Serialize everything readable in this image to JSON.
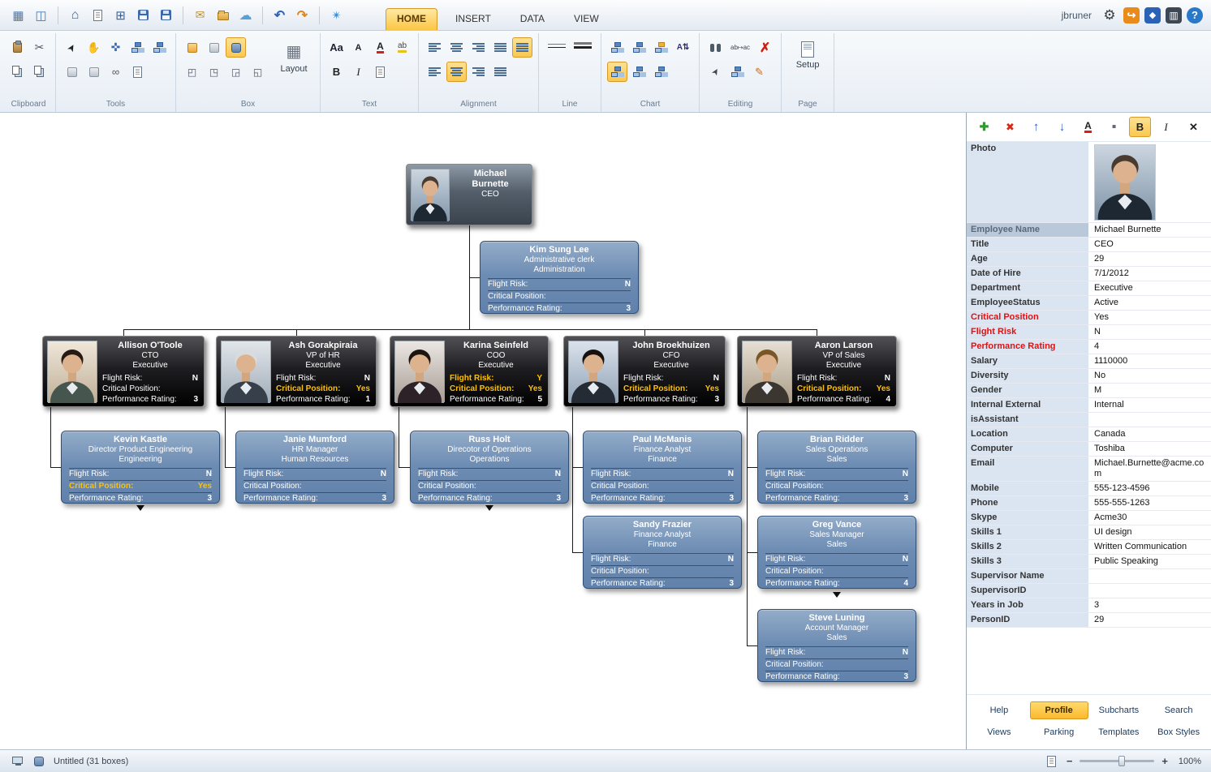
{
  "app": {
    "user": "jbruner",
    "tabs": [
      {
        "label": "HOME",
        "active": true
      },
      {
        "label": "INSERT",
        "active": false
      },
      {
        "label": "DATA",
        "active": false
      },
      {
        "label": "VIEW",
        "active": false
      }
    ]
  },
  "titlebar": {
    "left_icons": [
      "new-chart-wizard-icon",
      "photo-board-icon",
      "home-icon",
      "new-document-icon",
      "new-from-template-icon",
      "save-icon",
      "save-as-icon",
      "send-email-icon",
      "open-folder-icon",
      "cloud-share-icon",
      "undo-icon",
      "redo-icon",
      "help-online-icon"
    ],
    "right_icons": [
      "settings-gear-icon",
      "sign-out-icon",
      "premium-icon",
      "panels-icon",
      "help-icon"
    ]
  },
  "ribbon": {
    "groups": [
      {
        "label": "Clipboard",
        "rows": [
          [
            "paste-icon",
            "cut-icon"
          ],
          [
            "copy-icon",
            "duplicate-icon"
          ]
        ]
      },
      {
        "label": "Tools",
        "rows": [
          [
            "select-tool-icon",
            "pan-tool-icon",
            "move-tool-icon",
            "org-insert-icon",
            "org-subchart-icon"
          ],
          [
            "box-grid-icon",
            "box-remove-icon",
            "link-tool-icon",
            "note-tool-icon"
          ]
        ]
      },
      {
        "label": "Box",
        "rows": [
          [
            "box-style-gold-icon",
            "box-style-plain-icon",
            {
              "n": "box-style-current-icon",
              "sel": true
            }
          ],
          [
            "corner-square-icon",
            "corner-rounded-icon",
            "corner-cut-icon",
            "box-border-icon"
          ]
        ],
        "big": [
          {
            "name": "layout-button",
            "label": "Layout",
            "icon": "layout-grid-icon"
          }
        ]
      },
      {
        "label": "Text",
        "rows": [
          [
            "font-name-icon",
            "font-size-icon",
            "font-color-icon",
            "highlight-color-icon"
          ],
          [
            "bold-icon",
            "italic-icon",
            "text-fields-icon"
          ]
        ]
      },
      {
        "label": "Alignment",
        "rows": [
          [
            "align-left-icon",
            "align-center-icon",
            "align-right-icon",
            "align-justify-icon",
            {
              "n": "wrap-text-icon",
              "sel": true
            }
          ],
          [
            "valign-top-icon",
            {
              "n": "valign-middle-icon",
              "sel": true
            },
            "valign-bottom-icon",
            "distribute-icon"
          ]
        ]
      },
      {
        "label": "Line",
        "rows": [
          [
            "line-style-icon",
            "line-weight-icon"
          ]
        ]
      },
      {
        "label": "Chart",
        "rows": [
          [
            "layout-tree-icon",
            "layout-list-icon",
            "chart-color-icon",
            "sort-icon"
          ],
          [
            {
              "n": "chart-style-classic-icon",
              "sel": true
            },
            "chart-style-modern-icon",
            "chart-style-compact-icon"
          ]
        ]
      },
      {
        "label": "Editing",
        "rows": [
          [
            "find-icon",
            "replace-icon",
            "delete-box-icon"
          ],
          [
            "select-levels-icon",
            "insert-multi-icon",
            "format-painter-icon"
          ]
        ]
      },
      {
        "label": "Page",
        "rows": [],
        "big": [
          {
            "name": "page-setup-button",
            "label": "Setup",
            "icon": "page-setup-icon"
          }
        ]
      }
    ]
  },
  "org": {
    "boxes": [
      {
        "id": "michael",
        "style": "ceo",
        "name": "Michael Burnette",
        "title": "CEO",
        "dept": "",
        "fields": []
      },
      {
        "id": "kim",
        "style": "blue",
        "name": "Kim Sung Lee",
        "title": "Administrative clerk",
        "dept": "Administration",
        "fields": [
          {
            "label": "Flight Risk:",
            "value": "N"
          },
          {
            "label": "Critical Position:",
            "value": ""
          },
          {
            "label": "Performance Rating:",
            "value": "3"
          }
        ]
      },
      {
        "id": "allison",
        "style": "exec",
        "name": "Allison O'Toole",
        "title": "CTO",
        "dept": "Executive",
        "fields": [
          {
            "label": "Flight Risk:",
            "value": "N"
          },
          {
            "label": "Critical Position:",
            "value": ""
          },
          {
            "label": "Performance Rating:",
            "value": "3"
          }
        ]
      },
      {
        "id": "ash",
        "style": "exec",
        "name": "Ash Gorakpiraia",
        "title": "VP of HR",
        "dept": "Executive",
        "fields": [
          {
            "label": "Flight Risk:",
            "value": "N"
          },
          {
            "label": "Critical Position:",
            "value": "Yes",
            "hl": true
          },
          {
            "label": "Performance Rating:",
            "value": "1"
          }
        ]
      },
      {
        "id": "karina",
        "style": "exec",
        "name": "Karina Seinfeld",
        "title": "COO",
        "dept": "Executive",
        "fields": [
          {
            "label": "Flight Risk:",
            "value": "Y",
            "hl": true
          },
          {
            "label": "Critical Position:",
            "value": "Yes",
            "hl": true
          },
          {
            "label": "Performance Rating:",
            "value": "5"
          }
        ]
      },
      {
        "id": "john",
        "style": "exec",
        "name": "John Broekhuizen",
        "title": "CFO",
        "dept": "Executive",
        "fields": [
          {
            "label": "Flight Risk:",
            "value": "N"
          },
          {
            "label": "Critical Position:",
            "value": "Yes",
            "hl": true
          },
          {
            "label": "Performance Rating:",
            "value": "3"
          }
        ]
      },
      {
        "id": "aaron",
        "style": "exec",
        "name": "Aaron Larson",
        "title": "VP of Sales",
        "dept": "Executive",
        "fields": [
          {
            "label": "Flight Risk:",
            "value": "N"
          },
          {
            "label": "Critical Position:",
            "value": "Yes",
            "hl": true
          },
          {
            "label": "Performance Rating:",
            "value": "4"
          }
        ]
      },
      {
        "id": "kevin",
        "style": "blue",
        "name": "Kevin Kastle",
        "title": "Director Product Engineering",
        "dept": "Engineering",
        "fields": [
          {
            "label": "Flight Risk:",
            "value": "N"
          },
          {
            "label": "Critical Position:",
            "value": "Yes",
            "hl": true
          },
          {
            "label": "Performance Rating:",
            "value": "3"
          }
        ]
      },
      {
        "id": "janie",
        "style": "blue",
        "name": "Janie Mumford",
        "title": "HR Manager",
        "dept": "Human Resources",
        "fields": [
          {
            "label": "Flight Risk:",
            "value": "N"
          },
          {
            "label": "Critical Position:",
            "value": ""
          },
          {
            "label": "Performance Rating:",
            "value": "3"
          }
        ]
      },
      {
        "id": "russ",
        "style": "blue",
        "name": "Russ Holt",
        "title": "Direcotor of Operations",
        "dept": "Operations",
        "fields": [
          {
            "label": "Flight Risk:",
            "value": "N"
          },
          {
            "label": "Critical Position:",
            "value": ""
          },
          {
            "label": "Performance Rating:",
            "value": "3"
          }
        ]
      },
      {
        "id": "paul",
        "style": "blue",
        "name": "Paul McManis",
        "title": "Finance Analyst",
        "dept": "Finance",
        "fields": [
          {
            "label": "Flight Risk:",
            "value": "N"
          },
          {
            "label": "Critical Position:",
            "value": ""
          },
          {
            "label": "Performance Rating:",
            "value": "3"
          }
        ]
      },
      {
        "id": "brian",
        "style": "blue",
        "name": "Brian Ridder",
        "title": "Sales Operations",
        "dept": "Sales",
        "fields": [
          {
            "label": "Flight Risk:",
            "value": "N"
          },
          {
            "label": "Critical Position:",
            "value": ""
          },
          {
            "label": "Performance Rating:",
            "value": "3"
          }
        ]
      },
      {
        "id": "sandy",
        "style": "blue",
        "name": "Sandy Frazier",
        "title": "Finance Analyst",
        "dept": "Finance",
        "fields": [
          {
            "label": "Flight Risk:",
            "value": "N"
          },
          {
            "label": "Critical Position:",
            "value": ""
          },
          {
            "label": "Performance Rating:",
            "value": "3"
          }
        ]
      },
      {
        "id": "greg",
        "style": "blue",
        "name": "Greg Vance",
        "title": "Sales Manager",
        "dept": "Sales",
        "fields": [
          {
            "label": "Flight Risk:",
            "value": "N"
          },
          {
            "label": "Critical Position:",
            "value": ""
          },
          {
            "label": "Performance Rating:",
            "value": "4"
          }
        ]
      },
      {
        "id": "steve",
        "style": "blue",
        "name": "Steve Luning",
        "title": "Account Manager",
        "dept": "Sales",
        "fields": [
          {
            "label": "Flight Risk:",
            "value": "N"
          },
          {
            "label": "Critical Position:",
            "value": ""
          },
          {
            "label": "Performance Rating:",
            "value": "3"
          }
        ]
      }
    ]
  },
  "panel": {
    "toolbar": [
      "add-field-icon",
      "delete-field-icon",
      "move-up-icon",
      "move-down-icon",
      "font-color-icon",
      "highlight-icon",
      {
        "n": "bold-icon",
        "sel": true
      },
      "italic-icon"
    ],
    "close": "close-panel-icon",
    "photo_label": "Photo",
    "fields": [
      {
        "label": "Employee Name",
        "value": "Michael Burnette",
        "selected": true
      },
      {
        "label": "Title",
        "value": "CEO"
      },
      {
        "label": "Age",
        "value": "29"
      },
      {
        "label": "Date of Hire",
        "value": "7/1/2012"
      },
      {
        "label": "Department",
        "value": "Executive"
      },
      {
        "label": "EmployeeStatus",
        "value": "Active"
      },
      {
        "label": "Critical Position",
        "value": "Yes",
        "red": true
      },
      {
        "label": "Flight Risk",
        "value": "N",
        "red": true
      },
      {
        "label": "Performance Rating",
        "value": "4",
        "red": true
      },
      {
        "label": "Salary",
        "value": "1110000"
      },
      {
        "label": "Diversity",
        "value": "No"
      },
      {
        "label": "Gender",
        "value": "M"
      },
      {
        "label": "Internal External",
        "value": "Internal"
      },
      {
        "label": "isAssistant",
        "value": ""
      },
      {
        "label": "Location",
        "value": "Canada"
      },
      {
        "label": "Computer",
        "value": "Toshiba"
      },
      {
        "label": "Email",
        "value": "Michael.Burnette@acme.com"
      },
      {
        "label": "Mobile",
        "value": "555-123-4596"
      },
      {
        "label": "Phone",
        "value": "555-555-1263"
      },
      {
        "label": "Skype",
        "value": "Acme30"
      },
      {
        "label": "Skills 1",
        "value": "UI design"
      },
      {
        "label": "Skills 2",
        "value": "Written Communication"
      },
      {
        "label": "Skills 3",
        "value": "Public Speaking"
      },
      {
        "label": "Supervisor Name",
        "value": ""
      },
      {
        "label": "SupervisorID",
        "value": ""
      },
      {
        "label": "Years in Job",
        "value": "3"
      },
      {
        "label": "PersonID",
        "value": "29"
      }
    ],
    "tabs": [
      [
        {
          "label": "Help"
        },
        {
          "label": "Profile",
          "active": true
        },
        {
          "label": "Subcharts"
        },
        {
          "label": "Search"
        }
      ],
      [
        {
          "label": "Views"
        },
        {
          "label": "Parking"
        },
        {
          "label": "Templates"
        },
        {
          "label": "Box Styles"
        }
      ]
    ]
  },
  "statusbar": {
    "icons": [
      "connection-status-icon",
      "chart-file-icon"
    ],
    "fit_icon": "fit-page-icon",
    "document": "Untitled (31 boxes)",
    "zoom_out": "−",
    "zoom_in": "+",
    "zoom": "100%"
  }
}
